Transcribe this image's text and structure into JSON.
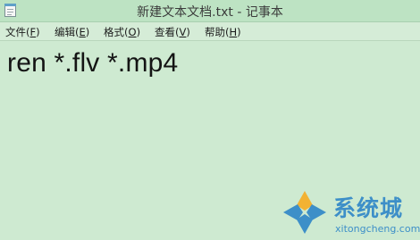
{
  "window": {
    "title": "新建文本文档.txt - 记事本"
  },
  "menubar": {
    "items": [
      {
        "label": "文件",
        "mnemonic_open": "(",
        "mnemonic": "F",
        "mnemonic_close": ")"
      },
      {
        "label": "编辑",
        "mnemonic_open": "(",
        "mnemonic": "E",
        "mnemonic_close": ")"
      },
      {
        "label": "格式",
        "mnemonic_open": "(",
        "mnemonic": "O",
        "mnemonic_close": ")"
      },
      {
        "label": "查看",
        "mnemonic_open": "(",
        "mnemonic": "V",
        "mnemonic_close": ")"
      },
      {
        "label": "帮助",
        "mnemonic_open": "(",
        "mnemonic": "H",
        "mnemonic_close": ")"
      }
    ]
  },
  "editor": {
    "content": "ren *.flv *.mp4"
  },
  "watermark": {
    "brand": "系统城",
    "url": "xitongcheng.com"
  },
  "colors": {
    "background": "#ceead1",
    "titlebar": "#bde3c3",
    "watermark": "#3d8fc8"
  },
  "icons": [
    "notepad-app-icon",
    "watermark-logo-icon"
  ]
}
